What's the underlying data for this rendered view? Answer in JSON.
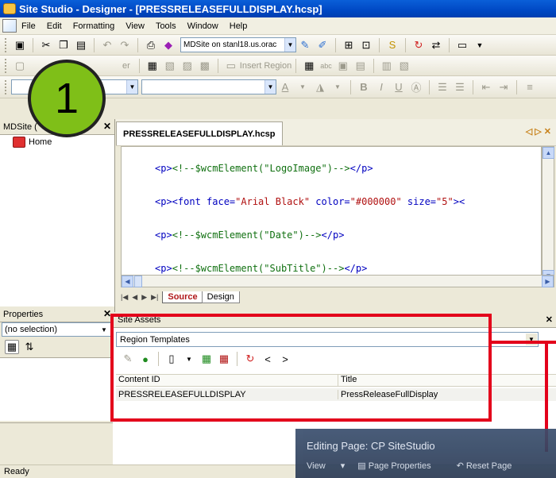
{
  "window": {
    "title": "Site Studio - Designer - [PRESSRELEASEFULLDISPLAY.hcsp]"
  },
  "menu": {
    "items": [
      "File",
      "Edit",
      "Formatting",
      "View",
      "Tools",
      "Window",
      "Help"
    ]
  },
  "toolbar": {
    "server_value": "MDSite on stanl18.us.orac",
    "insert_region_label": "Insert Region",
    "designer_label": "er",
    "abc_label": "abc"
  },
  "site_panel": {
    "title": "MDSite (",
    "home_label": "Home"
  },
  "editor": {
    "tab_label": "PRESSRELEASEFULLDISPLAY.hcsp",
    "tab_controls": "◁ ▷ ✕",
    "lines": [
      {
        "tag_open": "<p>",
        "comment": "<!--$wcmElement(\"LogoImage\")-->",
        "tag_close": "</p>"
      },
      {
        "tag_open": "<p><font face=",
        "value": "\"Arial Black\"",
        "rest": " color=",
        "value2": "\"#000000\"",
        "rest2": " size=",
        "value3": "\"5\"",
        "rest3": "><"
      },
      {
        "tag_open": "<p>",
        "comment": "<!--$wcmElement(\"Date\")-->",
        "tag_close": "</p>"
      },
      {
        "tag_open": "<p>",
        "comment": "<!--$wcmElement(\"SubTitle\")-->",
        "tag_close": "</p>"
      }
    ],
    "view_tabs": [
      "Source",
      "Design"
    ],
    "active_view": "Source"
  },
  "properties": {
    "title": "Properties",
    "selection": "(no selection)"
  },
  "assets": {
    "title": "Site Assets",
    "region_type": "Region Templates",
    "columns": [
      "Content ID",
      "Title"
    ],
    "rows": [
      {
        "content_id": "PRESSRELEASEFULLDISPLAY",
        "title": "PressReleaseFullDisplay"
      }
    ]
  },
  "status": {
    "text": "Ready"
  },
  "callout": {
    "number": "1"
  },
  "overlay": {
    "title": "Editing Page: CP SiteStudio",
    "view_label": "View",
    "page_properties": "Page Properties",
    "reset_page": "Reset Page"
  },
  "colors": {
    "highlight": "#e3001b",
    "callout": "#7fbf18",
    "titlebar": "#0a5fd8"
  }
}
